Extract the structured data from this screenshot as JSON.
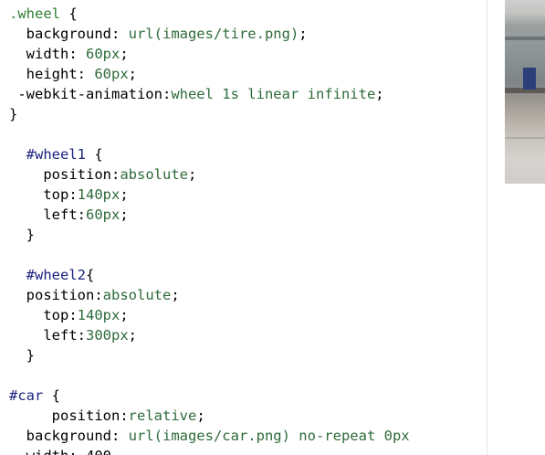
{
  "editor": {
    "lines": [
      [
        {
          "t": ".wheel",
          "c": "selector"
        },
        {
          "t": " {",
          "c": "punct"
        }
      ],
      [
        {
          "t": "  background: ",
          "c": "prop"
        },
        {
          "t": "url(images/tire.png)",
          "c": "value"
        },
        {
          "t": ";",
          "c": "punct"
        }
      ],
      [
        {
          "t": "  width: ",
          "c": "prop"
        },
        {
          "t": "60px",
          "c": "value"
        },
        {
          "t": ";",
          "c": "punct"
        }
      ],
      [
        {
          "t": "  height: ",
          "c": "prop"
        },
        {
          "t": "60px",
          "c": "value"
        },
        {
          "t": ";",
          "c": "punct"
        }
      ],
      [
        {
          "t": " -webkit-animation:",
          "c": "prop"
        },
        {
          "t": "wheel 1s linear infinite",
          "c": "value"
        },
        {
          "t": ";",
          "c": "punct"
        }
      ],
      [
        {
          "t": "}",
          "c": "punct"
        }
      ],
      [],
      [
        {
          "t": "  ",
          "c": "punct"
        },
        {
          "t": "#wheel1",
          "c": "id"
        },
        {
          "t": " {",
          "c": "punct"
        }
      ],
      [
        {
          "t": "    position:",
          "c": "prop"
        },
        {
          "t": "absolute",
          "c": "value"
        },
        {
          "t": ";",
          "c": "punct"
        }
      ],
      [
        {
          "t": "    top:",
          "c": "prop"
        },
        {
          "t": "140px",
          "c": "value"
        },
        {
          "t": ";",
          "c": "punct"
        }
      ],
      [
        {
          "t": "    left:",
          "c": "prop"
        },
        {
          "t": "60px",
          "c": "value"
        },
        {
          "t": ";",
          "c": "punct"
        }
      ],
      [
        {
          "t": "  }",
          "c": "punct"
        }
      ],
      [],
      [
        {
          "t": "  ",
          "c": "punct"
        },
        {
          "t": "#wheel2",
          "c": "id"
        },
        {
          "t": "{",
          "c": "punct"
        }
      ],
      [
        {
          "t": "  position:",
          "c": "prop"
        },
        {
          "t": "absolute",
          "c": "value"
        },
        {
          "t": ";",
          "c": "punct"
        }
      ],
      [
        {
          "t": "    top:",
          "c": "prop"
        },
        {
          "t": "140px",
          "c": "value"
        },
        {
          "t": ";",
          "c": "punct"
        }
      ],
      [
        {
          "t": "    left:",
          "c": "prop"
        },
        {
          "t": "300px",
          "c": "value"
        },
        {
          "t": ";",
          "c": "punct"
        }
      ],
      [
        {
          "t": "  }",
          "c": "punct"
        }
      ],
      [],
      [
        {
          "t": "#car",
          "c": "id"
        },
        {
          "t": " {",
          "c": "punct"
        }
      ],
      [
        {
          "t": "     position:",
          "c": "prop"
        },
        {
          "t": "relative",
          "c": "value"
        },
        {
          "t": ";",
          "c": "punct"
        }
      ],
      [
        {
          "t": "  background: ",
          "c": "prop"
        },
        {
          "t": "url(images/car.png) no-repeat 0px",
          "c": "value"
        }
      ],
      [
        {
          "t": "  width: 400",
          "c": "prop"
        }
      ]
    ]
  },
  "colors": {
    "selector": "#2e7d32",
    "id": "#1a237e",
    "value": "#2e6b3a",
    "text": "#000000",
    "background": "#ffffff"
  },
  "preview": {
    "image_icon": "photo-thumbnail-icon"
  }
}
